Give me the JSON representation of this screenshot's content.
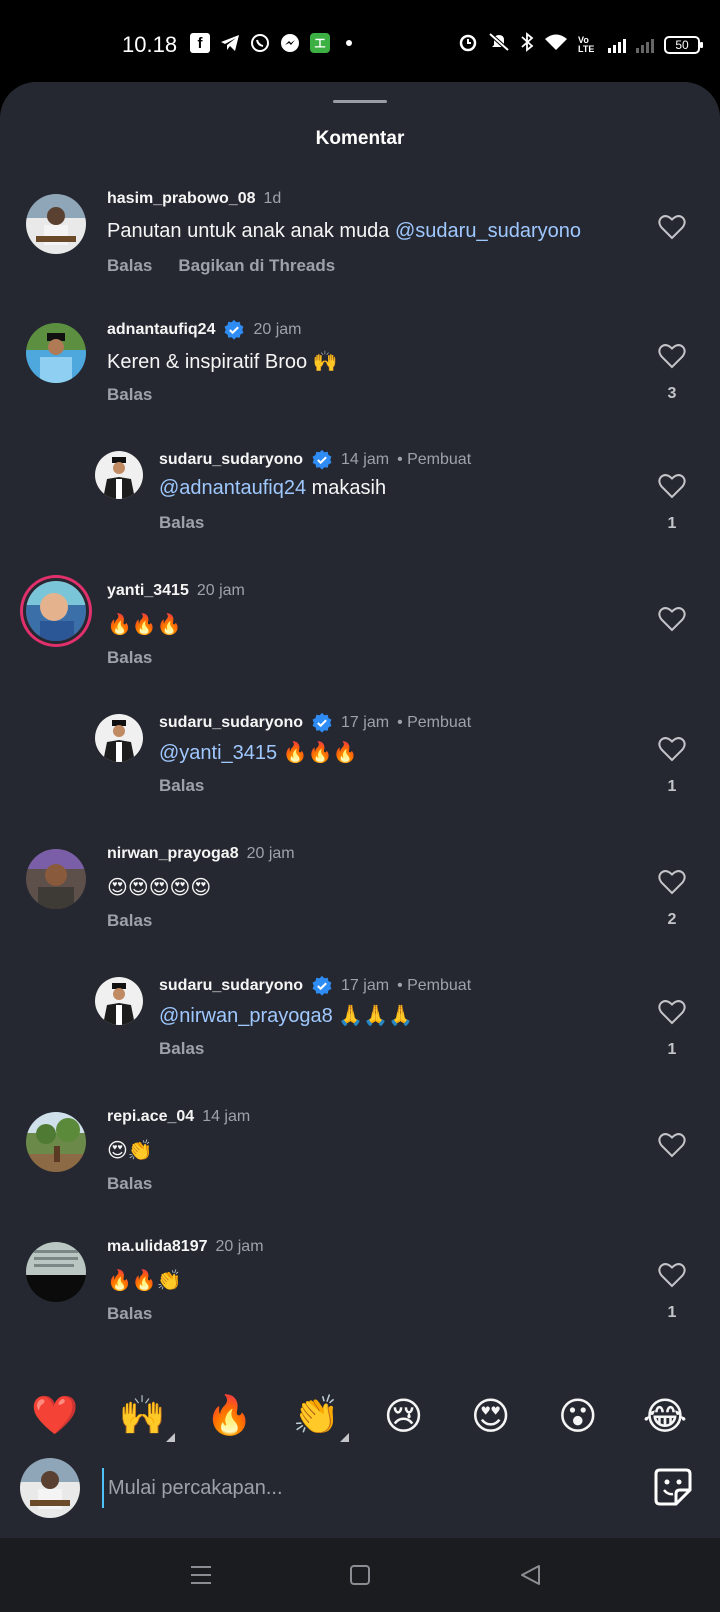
{
  "status_bar": {
    "time": "10.18",
    "battery": "50",
    "volte": "Vo LTE",
    "green_app_icon": "工"
  },
  "sheet": {
    "title": "Komentar"
  },
  "comments": [
    {
      "username": "hasim_prabowo_08",
      "time": "1d",
      "text": "Panutan untuk anak anak muda ",
      "mention": "@sudaru_sudaryono",
      "text_after": "",
      "actions": [
        "Balas",
        "Bagikan di Threads"
      ],
      "likes": "",
      "verified": false,
      "creator": ""
    },
    {
      "username": "adnantaufiq24",
      "time": "20 jam",
      "text": "Keren & inspiratif Broo 🙌",
      "mention": "",
      "text_after": "",
      "actions": [
        "Balas"
      ],
      "likes": "3",
      "verified": true,
      "creator": ""
    },
    {
      "username": "sudaru_sudaryono",
      "time": "14 jam",
      "text": "",
      "mention": "@adnantaufiq24",
      "text_after": " makasih",
      "actions": [
        "Balas"
      ],
      "likes": "1",
      "verified": true,
      "creator": "• Pembuat"
    },
    {
      "username": "yanti_3415",
      "time": "20 jam",
      "text": "🔥🔥🔥",
      "mention": "",
      "text_after": "",
      "actions": [
        "Balas"
      ],
      "likes": "",
      "verified": false,
      "creator": ""
    },
    {
      "username": "sudaru_sudaryono",
      "time": "17 jam",
      "text": "",
      "mention": "@yanti_3415",
      "text_after": " 🔥🔥🔥",
      "actions": [
        "Balas"
      ],
      "likes": "1",
      "verified": true,
      "creator": "• Pembuat"
    },
    {
      "username": "nirwan_prayoga8",
      "time": "20 jam",
      "text": "😍😍😍😍😍",
      "mention": "",
      "text_after": "",
      "actions": [
        "Balas"
      ],
      "likes": "2",
      "verified": false,
      "creator": ""
    },
    {
      "username": "sudaru_sudaryono",
      "time": "17 jam",
      "text": "",
      "mention": "@nirwan_prayoga8",
      "text_after": " 🙏🙏🙏",
      "actions": [
        "Balas"
      ],
      "likes": "1",
      "verified": true,
      "creator": "• Pembuat"
    },
    {
      "username": "repi.ace_04",
      "time": "14 jam",
      "text": "😍👏",
      "mention": "",
      "text_after": "",
      "actions": [
        "Balas"
      ],
      "likes": "",
      "verified": false,
      "creator": ""
    },
    {
      "username": "ma.ulida8197",
      "time": "20 jam",
      "text": "🔥🔥👏",
      "mention": "",
      "text_after": "",
      "actions": [
        "Balas"
      ],
      "likes": "1",
      "verified": false,
      "creator": ""
    }
  ],
  "emoji_bar": [
    "❤️",
    "🙌",
    "🔥",
    "👏",
    "😢",
    "😍",
    "😮",
    "😂"
  ],
  "input": {
    "placeholder": "Mulai percakapan..."
  },
  "colors": {
    "sheet_bg": "#252830",
    "mention": "#9fc8ff",
    "verified": "#2f8cf5",
    "muted_text": "#9ea2a8"
  },
  "icons": {
    "like": "heart-outline-icon",
    "verified": "verified-badge-icon",
    "sticker": "sticker-icon",
    "nav_menu": "menu-icon",
    "nav_home": "square-home-icon",
    "nav_back": "triangle-back-icon"
  }
}
